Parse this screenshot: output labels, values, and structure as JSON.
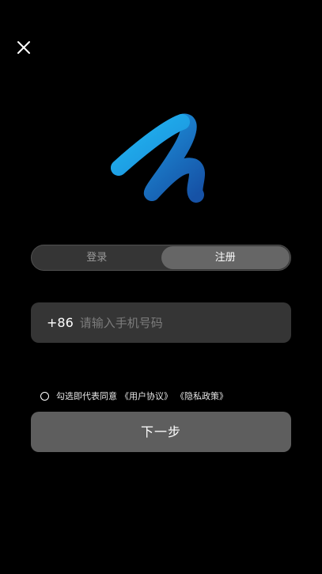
{
  "header": {
    "close_icon": "close-icon"
  },
  "logo": {
    "icon": "brand-logo-icon",
    "colors": {
      "light": "#1aa7e8",
      "dark": "#1552a8"
    }
  },
  "auth_tabs": [
    {
      "label": "登录",
      "active": false
    },
    {
      "label": "注册",
      "active": true
    }
  ],
  "phone": {
    "country_code": "+86",
    "value": "",
    "placeholder": "请输入手机号码"
  },
  "agreement": {
    "checked": false,
    "text": "勾选即代表同意",
    "user_agreement": "《用户协议》",
    "privacy_policy": "《隐私政策》"
  },
  "next_button": {
    "label": "下一步"
  }
}
